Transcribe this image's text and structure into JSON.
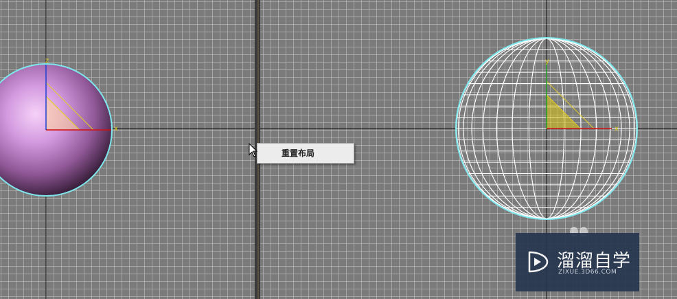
{
  "viewports": {
    "left": {
      "axis_labels": {
        "z": "z",
        "x": "x"
      }
    },
    "right": {
      "axis_labels": {
        "y": "y",
        "x": "x"
      }
    }
  },
  "context_menu": {
    "items": [
      {
        "label": "重置布局"
      }
    ]
  },
  "watermark": {
    "title": "溜溜自学",
    "url": "ZIXUE.3D66.COM"
  },
  "colors": {
    "selection": "#7ee8ee",
    "sphere": "#c88fd0",
    "wire": "#ffffff",
    "gizmo": "#e0d020"
  }
}
